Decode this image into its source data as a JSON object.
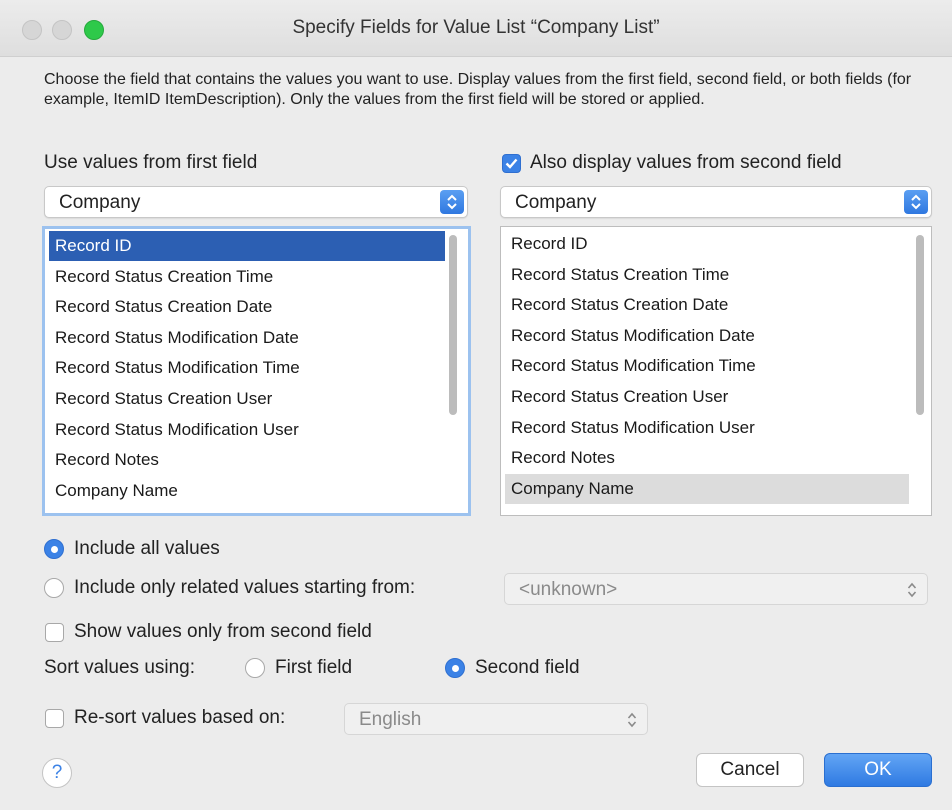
{
  "window": {
    "title": "Specify Fields for Value List “Company List”"
  },
  "description": "Choose the field that contains the values you want to use.  Display values from the first field, second field, or both fields (for example, ItemID ItemDescription). Only the values from the first field will be stored or applied.",
  "first_field": {
    "label": "Use values from first field",
    "table": "Company",
    "fields": [
      "Record ID",
      "Record Status Creation Time",
      "Record Status Creation Date",
      "Record Status Modification Date",
      "Record Status Modification Time",
      "Record Status Creation User",
      "Record Status Modification User",
      "Record Notes",
      "Company Name"
    ],
    "selected": "Record ID"
  },
  "second_field": {
    "label": "Also display values from second field",
    "checked": true,
    "table": "Company",
    "fields": [
      "Record ID",
      "Record Status Creation Time",
      "Record Status Creation Date",
      "Record Status Modification Date",
      "Record Status Modification Time",
      "Record Status Creation User",
      "Record Status Modification User",
      "Record Notes",
      "Company Name"
    ],
    "selected": "Company Name"
  },
  "include": {
    "all_label": "Include all values",
    "related_label": "Include only related values starting from:",
    "related_value": "<unknown>",
    "selected": "all"
  },
  "show_second_only": {
    "label": "Show values only from second field",
    "checked": false
  },
  "sort": {
    "label": "Sort values using:",
    "first_label": "First field",
    "second_label": "Second field",
    "selected": "second"
  },
  "resort": {
    "label": "Re-sort values based on:",
    "checked": false,
    "language": "English"
  },
  "buttons": {
    "help": "?",
    "cancel": "Cancel",
    "ok": "OK"
  },
  "colors": {
    "accent": "#3b82e6",
    "selection_blue": "#2c5fb3",
    "selection_grey": "#dcdcdc"
  }
}
